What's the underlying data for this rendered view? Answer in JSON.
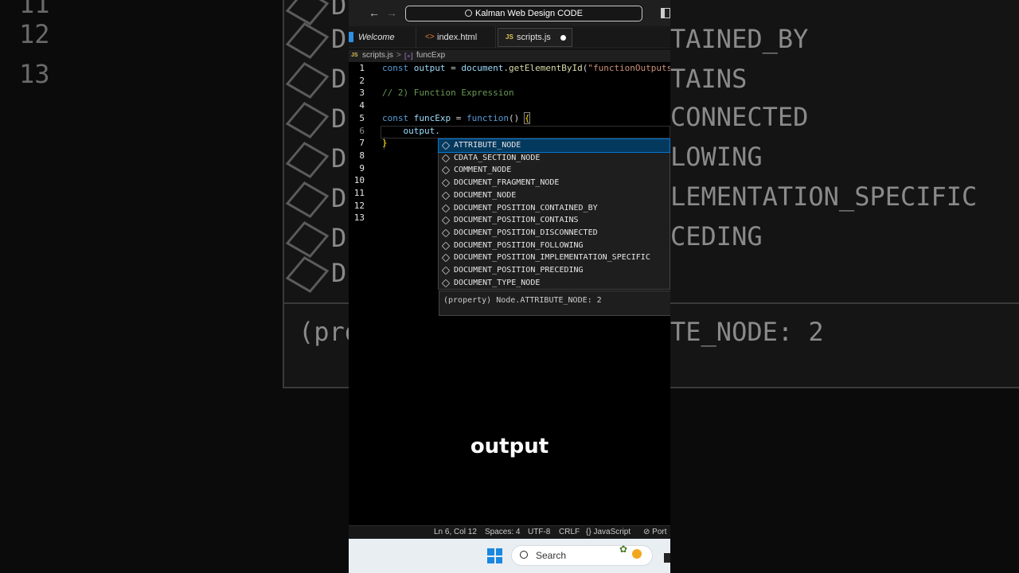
{
  "titlebar": {
    "search_text": "Kalman Web Design CODE",
    "back_icon": "arrow-left-icon",
    "forward_icon": "arrow-right-icon",
    "layout_icon": "toggle-sidebar-icon"
  },
  "tabs": [
    {
      "label": "Welcome",
      "icon": "vscode-icon"
    },
    {
      "label": "index.html",
      "icon": "html-icon",
      "icon_glyph": "<>"
    },
    {
      "label": "scripts.js",
      "icon": "js-icon",
      "icon_glyph": "JS",
      "modified": true
    }
  ],
  "breadcrumb": {
    "file_icon": "JS",
    "file": "scripts.js",
    "separator": ">",
    "symbol_icon": "[∘]",
    "symbol": "funcExp"
  },
  "editor": {
    "line_numbers": [
      "1",
      "2",
      "3",
      "4",
      "5",
      "6",
      "7",
      "8",
      "9",
      "10",
      "11",
      "12",
      "13"
    ],
    "current_line": 6,
    "line1": {
      "kw": "const",
      "var": "output",
      "eq": " = ",
      "obj": "document",
      "dot": ".",
      "fn": "getElementById",
      "open": "(",
      "str": "\"functionOutputs\"",
      "close": ")"
    },
    "line3": "// 2) Function Expression",
    "line5": {
      "kw": "const",
      "var": "funcExp",
      "eq": " = ",
      "fnkw": "function",
      "parens": "() ",
      "brace": "{"
    },
    "line6": "    output.",
    "line7": "}"
  },
  "suggestions": {
    "items": [
      "ATTRIBUTE_NODE",
      "CDATA_SECTION_NODE",
      "COMMENT_NODE",
      "DOCUMENT_FRAGMENT_NODE",
      "DOCUMENT_NODE",
      "DOCUMENT_POSITION_CONTAINED_BY",
      "DOCUMENT_POSITION_CONTAINS",
      "DOCUMENT_POSITION_DISCONNECTED",
      "DOCUMENT_POSITION_FOLLOWING",
      "DOCUMENT_POSITION_IMPLEMENTATION_SPECIFIC",
      "DOCUMENT_POSITION_PRECEDING",
      "DOCUMENT_TYPE_NODE"
    ],
    "selected_index": 0,
    "item_icon": "property-cube-icon",
    "detail": "(property) Node.ATTRIBUTE_NODE: 2"
  },
  "caption": "output",
  "statusbar": {
    "position": "Ln 6, Col 12",
    "spaces": "Spaces: 4",
    "encoding": "UTF-8",
    "eol": "CRLF",
    "language": "{} JavaScript",
    "ports": "Port"
  },
  "taskbar": {
    "search_placeholder": "Search",
    "start_icon": "windows-logo-icon"
  },
  "background": {
    "line_numbers": [
      "11",
      "12",
      "13"
    ],
    "rows_left": [
      "D",
      "D",
      "D",
      "D",
      "D",
      "D",
      "D"
    ],
    "rows_right": [
      "TAINED_BY",
      "TAINS",
      "CONNECTED",
      "LOWING",
      "LEMENTATION_SPECIFIC",
      "CEDING"
    ],
    "hover_left": "(pro",
    "hover_right": "TE_NODE: 2"
  },
  "colors": {
    "keyword": "#569cd6",
    "variable": "#9cdcfe",
    "function": "#dcdcaa",
    "string": "#ce9178",
    "comment": "#6a9955",
    "selection": "#04395e",
    "accent": "#0078d4"
  }
}
